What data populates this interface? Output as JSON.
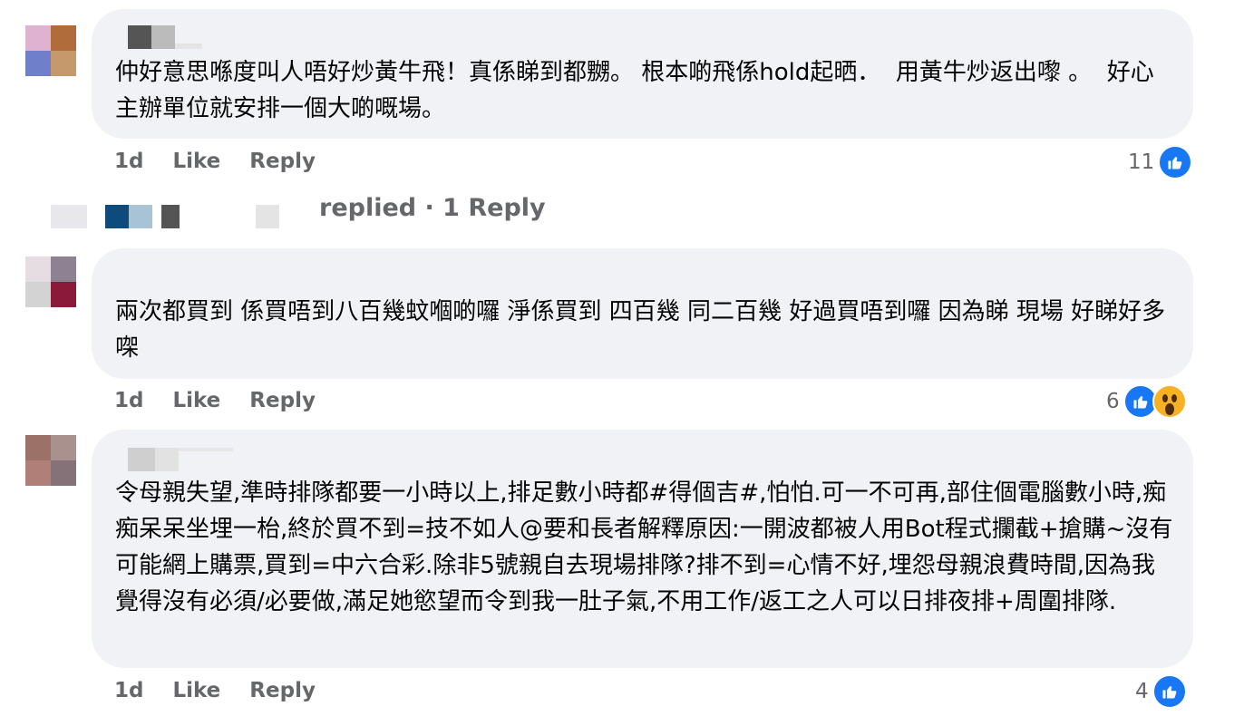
{
  "colors": {
    "bubble_bg": "#f0f2f5",
    "muted_text": "#65676b",
    "like_blue": "#1877f2",
    "wow_yellow": "#f7b125"
  },
  "comments": [
    {
      "avatar_colors": [
        "#e0b2d2",
        "#b06d3b",
        "#6f7fca",
        "#c49a6c"
      ],
      "text": "仲好意思喺度叫人唔好炒黃牛飛！真係睇到都嬲。 根本啲飛係hold起晒．  用黃牛炒返出嚟 。  好心主辦單位就安排一個大啲嘅場。",
      "time": "1d",
      "like_label": "Like",
      "reply_label": "Reply",
      "reaction_count": "11",
      "reactions": [
        "like-icon"
      ]
    },
    {
      "avatar_colors": [
        "#e6dde2",
        "#8e8292",
        "#d3d3d3",
        "#8b1a3a"
      ],
      "text": "兩次都買到 係買唔到八百幾蚊嗰啲囉 淨係買到 四百幾 同二百幾 好過買唔到囉 因為睇 現場 好睇好多㗎",
      "time": "1d",
      "like_label": "Like",
      "reply_label": "Reply",
      "reaction_count": "6",
      "reactions": [
        "like-icon",
        "wow-icon"
      ]
    },
    {
      "avatar_colors": [
        "#9c7268",
        "#a9928d",
        "#b07f78",
        "#857279"
      ],
      "text": "令母親失望,準時排隊都要一小時以上,排足數小時都#得個吉#,怕怕.可一不可再,部住個電腦數小時,痴痴呆呆坐埋一枱,終於買不到=技不如人@要和長者解釋原因:一開波都被人用Bot程式攔截+搶購~沒有可能網上購票,買到=中六合彩.除非5號親自去現場排隊?排不到=心情不好,埋怨母親浪費時間,因為我覺得沒有必須/必要做,滿足她慾望而令到我一肚子氣,不用工作/返工之人可以日排夜排+周圍排隊.",
      "time": "1d",
      "like_label": "Like",
      "reply_label": "Reply",
      "reaction_count": "4",
      "reactions": [
        "like-icon"
      ]
    }
  ],
  "replies_link": {
    "text": "replied · 1 Reply"
  }
}
